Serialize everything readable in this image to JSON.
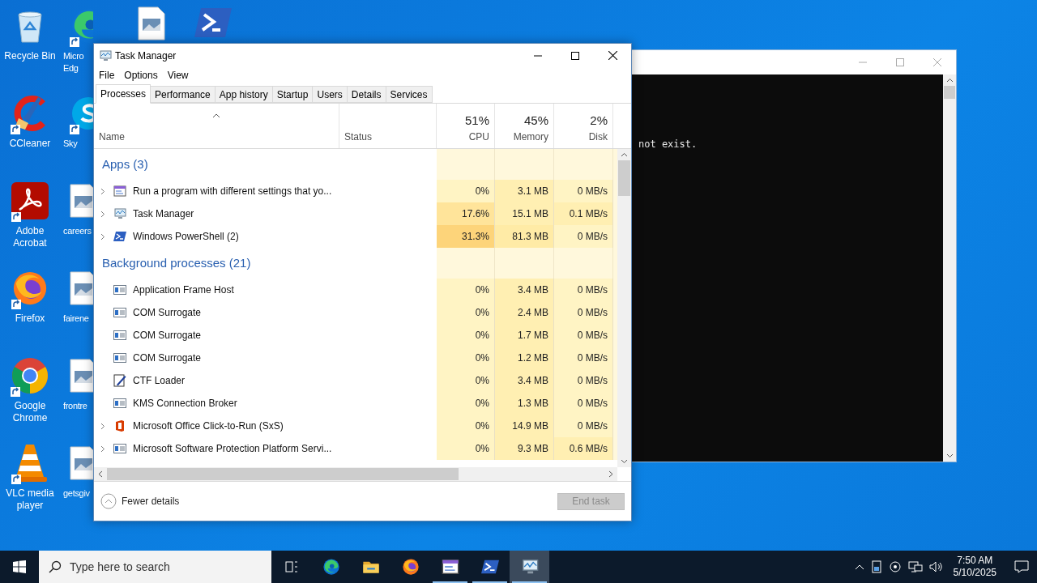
{
  "desktop": {
    "column_1": [
      {
        "kind": "recycle",
        "shortcut": false,
        "label_lines": [
          "Recycle Bin"
        ]
      },
      {
        "kind": "ccleaner",
        "shortcut": true,
        "label_lines": [
          "CCleaner"
        ]
      },
      {
        "kind": "acrobat",
        "shortcut": true,
        "label_lines": [
          "Adobe",
          "Acrobat"
        ]
      },
      {
        "kind": "firefox",
        "shortcut": true,
        "label_lines": [
          "Firefox"
        ]
      },
      {
        "kind": "chrome",
        "shortcut": true,
        "label_lines": [
          "Google",
          "Chrome"
        ]
      },
      {
        "kind": "vlc",
        "shortcut": true,
        "label_lines": [
          "VLC media",
          "player"
        ]
      }
    ],
    "column_2": [
      {
        "kind": "edge",
        "shortcut": true,
        "label_lines": [
          "Micro",
          "Edg"
        ]
      },
      {
        "kind": "skype",
        "shortcut": true,
        "label_lines": [
          "Sky"
        ]
      },
      {
        "kind": "file",
        "shortcut": false,
        "label_lines": [
          "careers"
        ]
      },
      {
        "kind": "file",
        "shortcut": false,
        "label_lines": [
          "fairene"
        ]
      },
      {
        "kind": "file",
        "shortcut": false,
        "label_lines": [
          "frontre"
        ]
      },
      {
        "kind": "file",
        "shortcut": false,
        "label_lines": [
          "getsgiv"
        ]
      }
    ],
    "top_row": [
      {
        "kind": "file",
        "shortcut": false
      },
      {
        "kind": "powershell",
        "shortcut": false
      }
    ]
  },
  "console_window": {
    "lines": [
      "not exist."
    ]
  },
  "task_manager": {
    "title": "Task Manager",
    "menu": [
      "File",
      "Options",
      "View"
    ],
    "tabs": [
      {
        "label": "Processes",
        "selected": true
      },
      {
        "label": "Performance",
        "selected": false
      },
      {
        "label": "App history",
        "selected": false
      },
      {
        "label": "Startup",
        "selected": false
      },
      {
        "label": "Users",
        "selected": false
      },
      {
        "label": "Details",
        "selected": false
      },
      {
        "label": "Services",
        "selected": false
      }
    ],
    "columns": [
      {
        "label": "Name",
        "sorted": true
      },
      {
        "label": "Status",
        "sorted": false
      },
      {
        "label": "CPU",
        "total": "51%",
        "sorted": false
      },
      {
        "label": "Memory",
        "total": "45%",
        "sorted": false
      },
      {
        "label": "Disk",
        "total": "2%",
        "sorted": false
      }
    ],
    "groups": [
      {
        "title": "Apps (3)",
        "rows": [
          {
            "name": "Run a program with different settings that yo...",
            "kind": "run",
            "expandable": true,
            "cpu": {
              "text": "0%",
              "color": "#fff4c4"
            },
            "memory": {
              "text": "3.1 MB",
              "color": "#ffefb2"
            },
            "disk": {
              "text": "0 MB/s",
              "color": "#fff4c4"
            }
          },
          {
            "name": "Task Manager",
            "kind": "taskmgr",
            "expandable": true,
            "cpu": {
              "text": "17.6%",
              "color": "#ffe49a"
            },
            "memory": {
              "text": "15.1 MB",
              "color": "#ffefb2"
            },
            "disk": {
              "text": "0.1 MB/s",
              "color": "#ffefb2"
            }
          },
          {
            "name": "Windows PowerShell (2)",
            "kind": "powershell",
            "expandable": true,
            "cpu": {
              "text": "31.3%",
              "color": "#fdd47a"
            },
            "memory": {
              "text": "81.3 MB",
              "color": "#ffeba6"
            },
            "disk": {
              "text": "0 MB/s",
              "color": "#fff4c4"
            }
          }
        ]
      },
      {
        "title": "Background processes (21)",
        "rows": [
          {
            "name": "Application Frame Host",
            "kind": "frame",
            "expandable": false,
            "cpu": {
              "text": "0%",
              "color": "#fff4c4"
            },
            "memory": {
              "text": "3.4 MB",
              "color": "#ffefb2"
            },
            "disk": {
              "text": "0 MB/s",
              "color": "#fff4c4"
            }
          },
          {
            "name": "COM Surrogate",
            "kind": "frame",
            "expandable": false,
            "cpu": {
              "text": "0%",
              "color": "#fff4c4"
            },
            "memory": {
              "text": "2.4 MB",
              "color": "#ffefb2"
            },
            "disk": {
              "text": "0 MB/s",
              "color": "#fff4c4"
            }
          },
          {
            "name": "COM Surrogate",
            "kind": "frame",
            "expandable": false,
            "cpu": {
              "text": "0%",
              "color": "#fff4c4"
            },
            "memory": {
              "text": "1.7 MB",
              "color": "#ffefb2"
            },
            "disk": {
              "text": "0 MB/s",
              "color": "#fff4c4"
            }
          },
          {
            "name": "COM Surrogate",
            "kind": "frame",
            "expandable": false,
            "cpu": {
              "text": "0%",
              "color": "#fff4c4"
            },
            "memory": {
              "text": "1.2 MB",
              "color": "#ffefb2"
            },
            "disk": {
              "text": "0 MB/s",
              "color": "#fff4c4"
            }
          },
          {
            "name": "CTF Loader",
            "kind": "ctf",
            "expandable": false,
            "cpu": {
              "text": "0%",
              "color": "#fff4c4"
            },
            "memory": {
              "text": "3.4 MB",
              "color": "#ffefb2"
            },
            "disk": {
              "text": "0 MB/s",
              "color": "#fff4c4"
            }
          },
          {
            "name": "KMS Connection Broker",
            "kind": "frame",
            "expandable": false,
            "cpu": {
              "text": "0%",
              "color": "#fff4c4"
            },
            "memory": {
              "text": "1.3 MB",
              "color": "#ffefb2"
            },
            "disk": {
              "text": "0 MB/s",
              "color": "#fff4c4"
            }
          },
          {
            "name": "Microsoft Office Click-to-Run (SxS)",
            "kind": "office",
            "expandable": true,
            "cpu": {
              "text": "0%",
              "color": "#fff4c4"
            },
            "memory": {
              "text": "14.9 MB",
              "color": "#ffefb2"
            },
            "disk": {
              "text": "0 MB/s",
              "color": "#fff4c4"
            }
          },
          {
            "name": "Microsoft Software Protection Platform Servi...",
            "kind": "frame",
            "expandable": true,
            "cpu": {
              "text": "0%",
              "color": "#fff4c4"
            },
            "memory": {
              "text": "9.3 MB",
              "color": "#ffefb2"
            },
            "disk": {
              "text": "0.6 MB/s",
              "color": "#ffefb2"
            }
          }
        ]
      }
    ],
    "fewer_details": "Fewer details",
    "end_task": {
      "label": "End task",
      "disabled": true
    }
  },
  "taskbar": {
    "search_placeholder": "Type here to search",
    "apps": [
      {
        "kind": "edge",
        "running": false,
        "active": false
      },
      {
        "kind": "explorer",
        "running": false,
        "active": false
      },
      {
        "kind": "firefox",
        "running": false,
        "active": false
      },
      {
        "kind": "run",
        "running": true,
        "active": false
      },
      {
        "kind": "powershell",
        "running": true,
        "active": false
      },
      {
        "kind": "taskmgr",
        "running": true,
        "active": true
      }
    ],
    "time": "7:50 AM",
    "date": "5/10/2025"
  }
}
